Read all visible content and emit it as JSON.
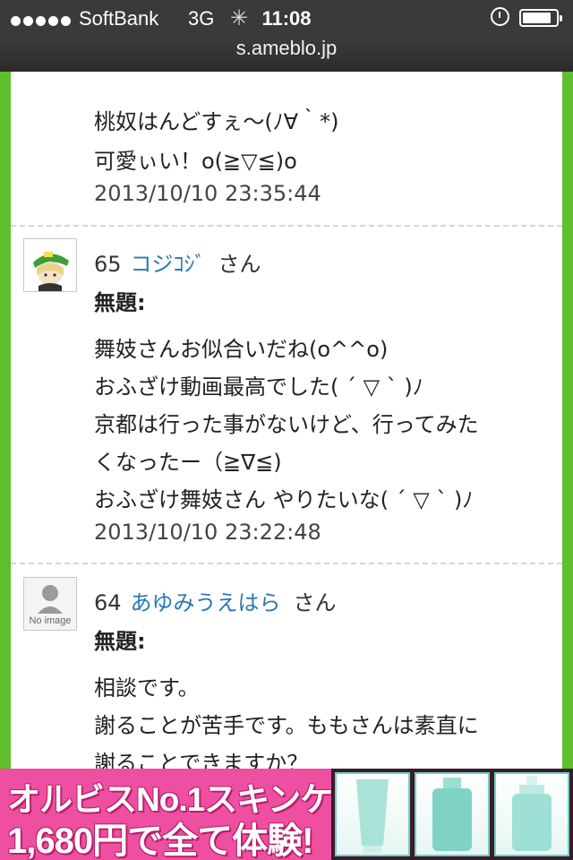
{
  "status_bar": {
    "carrier": "SoftBank",
    "network": "3G",
    "time": "11:08",
    "battery_level": 0.85
  },
  "url_bar": {
    "url": "s.ameblo.jp"
  },
  "comments": [
    {
      "lines": [
        "桃奴はんどすぇ〜(ﾉ∀｀*)",
        "可愛ぃい！o(≧▽≦)o"
      ],
      "date": "2013/10/10 23:35:44"
    },
    {
      "number": "65",
      "author": "コジｺｼﾞ",
      "honorific": "さん",
      "subject": "無題:",
      "lines": [
        "舞妓さんお似合いだね(o^^o)",
        "おふざけ動画最高でした( ´ ▽ ` )ﾉ",
        "京都は行った事がないけど、行ってみた",
        "くなったー（≧∇≦)",
        "おふざけ舞妓さん やりたいな( ´ ▽ ` )ﾉ"
      ],
      "date": "2013/10/10 23:22:48",
      "avatar_icon": "user-avatar-icon"
    },
    {
      "number": "64",
      "author": "あゆみうえはら",
      "honorific": "さん",
      "subject": "無題:",
      "lines": [
        "相談です。",
        "謝ることが苦手です。ももさんは素直に",
        "謝ることできますか？"
      ],
      "avatar_icon": "no-image-avatar-icon",
      "avatar_label": "No image"
    }
  ],
  "ad_banner": {
    "line1": "オルビスNo.1スキンケア",
    "line2": "1,680円で全て体験!"
  },
  "colors": {
    "page_green": "#5fbf2b",
    "author_link": "#2a78b5",
    "ad_pink": "#ee4fa0"
  }
}
